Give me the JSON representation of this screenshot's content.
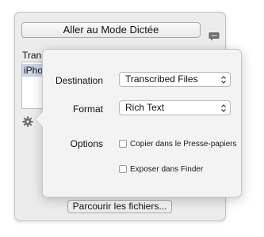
{
  "panel": {
    "dictation_button": "Aller au Mode Dictée",
    "transcripts_label": "Trans",
    "file_list": [
      "iPho"
    ],
    "browse_button": "Parcourir les fichiers..."
  },
  "popover": {
    "destination_label": "Destination",
    "destination_value": "Transcribed Files",
    "format_label": "Format",
    "format_value": "Rich Text",
    "options_label": "Options",
    "option_clipboard": "Copier dans le Presse-papiers",
    "option_clipboard_checked": false,
    "option_finder": "Exposer dans Finder",
    "option_finder_checked": false
  },
  "icons": {
    "speech": "speech-bubble-icon",
    "gear": "gear-icon",
    "chevrons": "up-down-chevron-icon"
  }
}
